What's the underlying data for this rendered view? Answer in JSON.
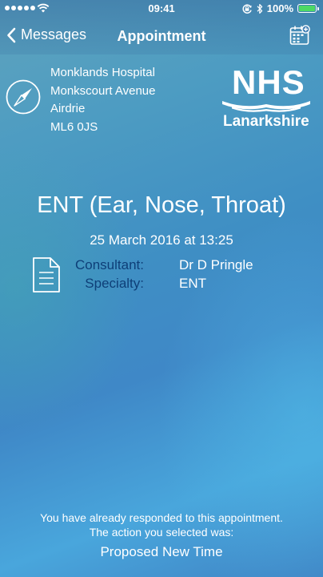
{
  "status_bar": {
    "time": "09:41",
    "battery_percent_label": "100%",
    "battery_level": 1.0,
    "battery_color": "#4cd964",
    "icons": [
      "signal-dots-icon",
      "wifi-icon",
      "rotation-lock-icon",
      "bluetooth-icon",
      "battery-icon"
    ]
  },
  "nav": {
    "back_label": "Messages",
    "title": "Appointment",
    "right_icon": "calendar-add-icon"
  },
  "location": {
    "icon": "compass-icon",
    "lines": [
      "Monklands Hospital",
      "Monkscourt Avenue",
      "Airdrie",
      "ML6 0JS"
    ]
  },
  "logo": {
    "wordmark": "NHS",
    "region": "Lanarkshire"
  },
  "appointment": {
    "title": "ENT (Ear, Nose, Throat)",
    "datetime": "25 March 2016 at 13:25",
    "details_icon": "document-icon",
    "details": [
      {
        "label": "Consultant:",
        "value": "Dr D Pringle"
      },
      {
        "label": "Specialty:",
        "value": "ENT"
      }
    ]
  },
  "footer": {
    "line1": "You have already responded to this appointment.",
    "line2": "The action you selected was:",
    "action": "Proposed New Time"
  },
  "colors": {
    "label_text": "#0e3f78",
    "primary_text": "#ffffff"
  }
}
